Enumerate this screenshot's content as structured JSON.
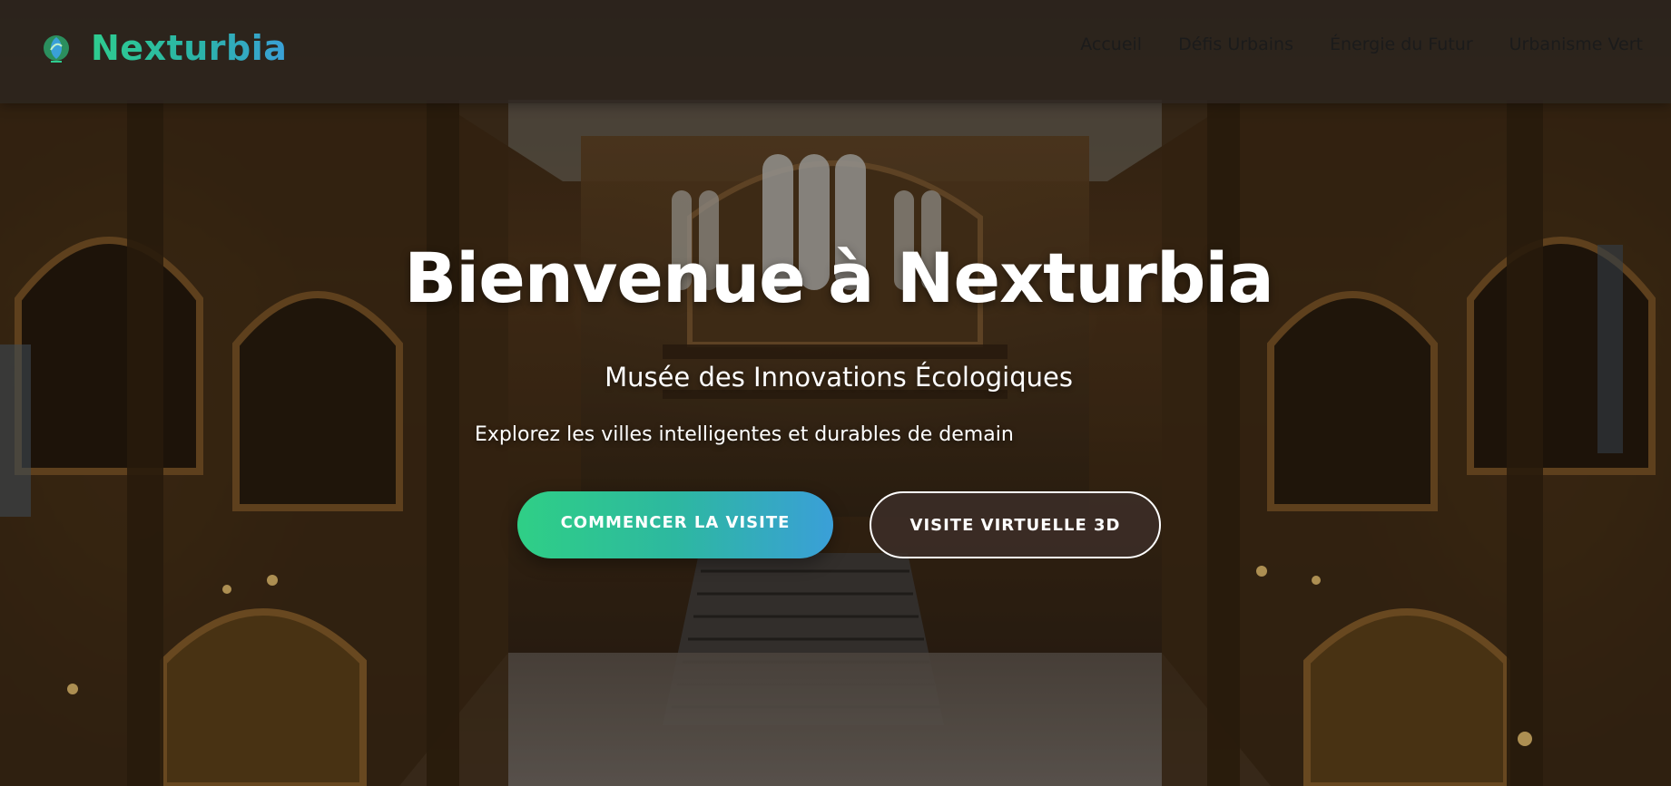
{
  "navbar": {
    "brand_name": "Nexturbia",
    "logo_icon": "leaf-globe-icon",
    "links": [
      {
        "label": "Accueil"
      },
      {
        "label": "Défis Urbains"
      },
      {
        "label": "Énergie du Futur"
      },
      {
        "label": "Urbanisme Vert"
      }
    ]
  },
  "hero": {
    "title": "Bienvenue à Nexturbia",
    "subtitle": "Musée des Innovations Écologiques",
    "tagline": "Explorez les villes intelligentes et durables de demain",
    "primary_button": "COMMENCER LA VISITE",
    "secondary_button": "VISITE VIRTUELLE 3D"
  },
  "colors": {
    "brand_gradient_start": "#2ecc8f",
    "brand_gradient_end": "#3aa0d8",
    "text_light": "#ffffff",
    "nav_text": "#1b1b1b"
  }
}
